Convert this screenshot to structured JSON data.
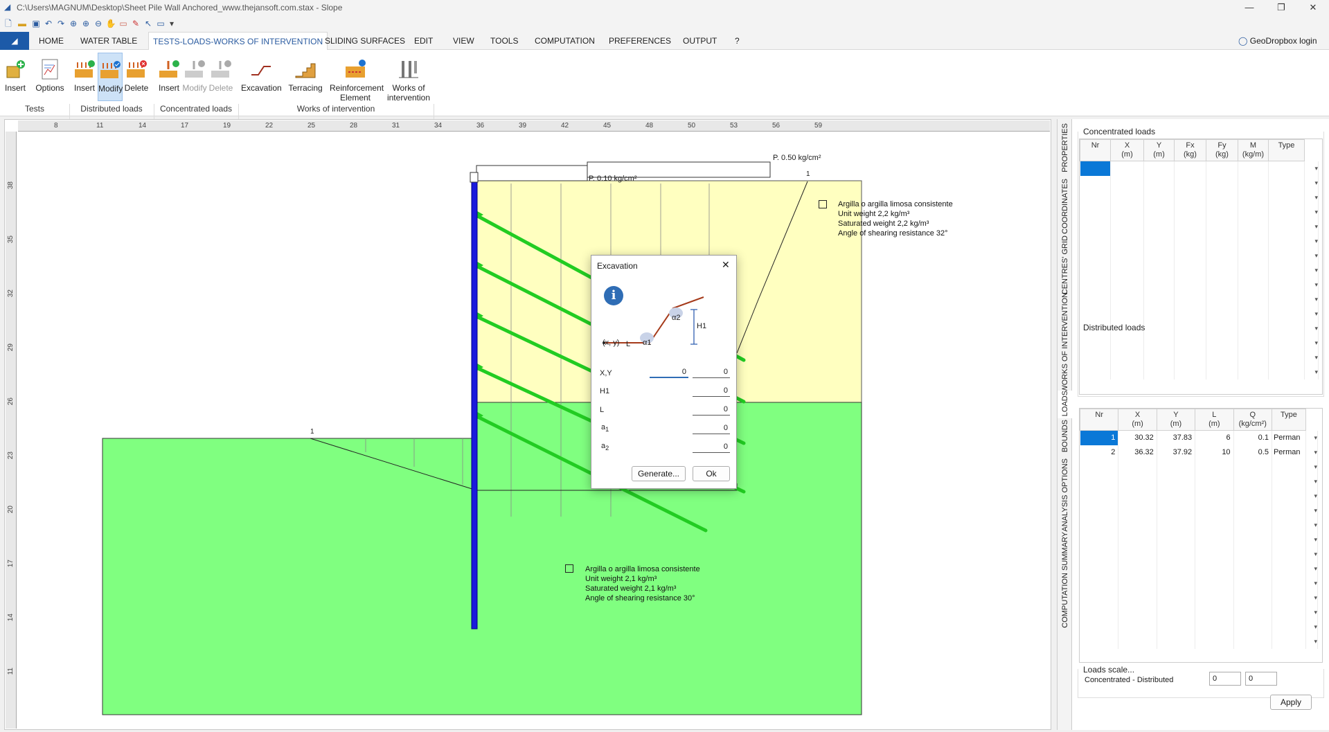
{
  "window": {
    "title": "C:\\Users\\MAGNUM\\Desktop\\Sheet Pile Wall Anchored_www.thejansoft.com.stax - Slope",
    "minimize": "—",
    "maximize": "❐",
    "close": "✕"
  },
  "menu": {
    "tabs": [
      "HOME",
      "WATER TABLE",
      "TESTS-LOADS-WORKS OF INTERVENTION",
      "SLIDING SURFACES",
      "EDIT",
      "VIEW",
      "TOOLS",
      "COMPUTATION",
      "PREFERENCES",
      "OUTPUT",
      "?"
    ],
    "active": "TESTS-LOADS-WORKS OF INTERVENTION",
    "login": "GeoDropbox login"
  },
  "ribbon": {
    "tests": {
      "insert": "Insert",
      "options": "Options",
      "group": "Tests"
    },
    "distributed": {
      "insert": "Insert",
      "modify": "Modify",
      "delete": "Delete",
      "group": "Distributed loads"
    },
    "concentrated": {
      "insert": "Insert",
      "modify": "Modify",
      "delete": "Delete",
      "group": "Concentrated loads"
    },
    "works": {
      "excavation": "Excavation",
      "terracing": "Terracing",
      "reinforcement_l1": "Reinforcement",
      "reinforcement_l2": "Element",
      "works_l1": "Works of",
      "works_l2": "intervention",
      "group": "Works of intervention"
    }
  },
  "ruler": {
    "x_ticks": [
      "8",
      "11",
      "14",
      "17",
      "19",
      "22",
      "25",
      "28",
      "31",
      "34",
      "36",
      "39",
      "42",
      "45",
      "48",
      "50",
      "53",
      "56",
      "59"
    ],
    "y_ticks": [
      "38",
      "35",
      "32",
      "29",
      "26",
      "23",
      "20",
      "17",
      "14",
      "11"
    ]
  },
  "canvas": {
    "load_top_label": "P. 0.50 kg/cm²",
    "load_inner_label": "P. 0.10 kg/cm²",
    "marker_1a": "1",
    "marker_1b": "1",
    "layer1": {
      "name": "Argilla o argilla limosa consistente",
      "unit_weight": "Unit weight 2,2 kg/m³",
      "saturated": "Saturated weight  2,2 kg/m³",
      "angle": "Angle of shearing resistance 32°",
      "color": "#ffffc0"
    },
    "layer2": {
      "name": "Argilla o argilla limosa consistente",
      "unit_weight": "Unit weight 2,1 kg/m³",
      "saturated": "Saturated weight  2,1 kg/m³",
      "angle": "Angle of shearing resistance 30°",
      "color": "#80ff80"
    },
    "wall_color": "#1a1adc",
    "anchor_color": "#22cc22"
  },
  "dialog": {
    "title": "Excavation",
    "diagram": {
      "xy": "(x, y)",
      "l": "L",
      "a1": "α1",
      "a2": "α2",
      "h1": "H1"
    },
    "fields": {
      "xy_label": "X,Y",
      "x_value": "0",
      "y_value": "0",
      "h1_label": "H1",
      "h1_value": "0",
      "l_label": "L",
      "l_value": "0",
      "a1_label": "a",
      "a1_sub": "1",
      "a1_value": "0",
      "a2_label": "a",
      "a2_sub": "2",
      "a2_value": "0"
    },
    "generate": "Generate...",
    "ok": "Ok"
  },
  "side_tabs": [
    "PROPERTIES",
    "COORDINATES",
    "CENTRES' GRID",
    "WORKS OF INTERVENTION",
    "LOADS",
    "BOUNDS",
    "ANALYSIS OPTIONS",
    "COMPUTATION SUMMARY"
  ],
  "concentrated_loads": {
    "title": "Concentrated loads",
    "headers": [
      [
        "Nr",
        ""
      ],
      [
        "X",
        "(m)"
      ],
      [
        "Y",
        "(m)"
      ],
      [
        "Fx",
        "(kg)"
      ],
      [
        "Fy",
        "(kg)"
      ],
      [
        "M",
        "(kg/m)"
      ],
      [
        "Type",
        ""
      ]
    ]
  },
  "distributed_loads": {
    "title": "Distributed loads",
    "headers": [
      [
        "Nr",
        ""
      ],
      [
        "X",
        "(m)"
      ],
      [
        "Y",
        "(m)"
      ],
      [
        "L",
        "(m)"
      ],
      [
        "Q",
        "(kg/cm²)"
      ],
      [
        "Type",
        ""
      ]
    ],
    "rows": [
      {
        "nr": "1",
        "x": "30.32",
        "y": "37.83",
        "l": "6",
        "q": "0.1",
        "type": "Perman"
      },
      {
        "nr": "2",
        "x": "36.32",
        "y": "37.92",
        "l": "10",
        "q": "0.5",
        "type": "Perman"
      }
    ]
  },
  "loads_scale": {
    "title": "Loads scale...",
    "label": "Concentrated - Distributed",
    "v1": "0",
    "v2": "0",
    "apply": "Apply"
  }
}
